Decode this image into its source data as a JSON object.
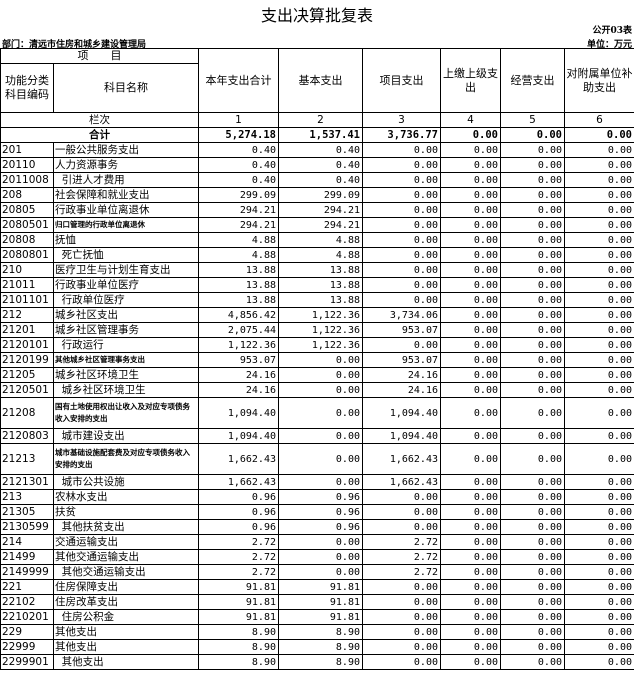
{
  "title": "支出决算批复表",
  "form_code": "公开03表",
  "department": "部门：清远市住房和城乡建设管理局",
  "unit": "单位：万元",
  "headers": {
    "item": "项　　目",
    "func_code": "功能分类科目编码",
    "item_name": "科目名称",
    "col1": "本年支出合计",
    "col2": "基本支出",
    "col3": "项目支出",
    "col4": "上缴上级支出",
    "col5": "经营支出",
    "col6": "对附属单位补助支出",
    "lanci": "栏次",
    "n1": "1",
    "n2": "2",
    "n3": "3",
    "n4": "4",
    "n5": "5",
    "n6": "6"
  },
  "total": {
    "label": "合计",
    "v1": "5,274.18",
    "v2": "1,537.41",
    "v3": "3,736.77",
    "v4": "0.00",
    "v5": "0.00",
    "v6": "0.00"
  },
  "rows": [
    {
      "code": "201",
      "name": "一般公共服务支出",
      "v1": "0.40",
      "v2": "0.40",
      "v3": "0.00",
      "v4": "0.00",
      "v5": "0.00",
      "v6": "0.00"
    },
    {
      "code": "20110",
      "name": "人力资源事务",
      "v1": "0.40",
      "v2": "0.40",
      "v3": "0.00",
      "v4": "0.00",
      "v5": "0.00",
      "v6": "0.00"
    },
    {
      "code": "2011008",
      "name": "  引进人才费用",
      "v1": "0.40",
      "v2": "0.40",
      "v3": "0.00",
      "v4": "0.00",
      "v5": "0.00",
      "v6": "0.00"
    },
    {
      "code": "208",
      "name": "社会保障和就业支出",
      "v1": "299.09",
      "v2": "299.09",
      "v3": "0.00",
      "v4": "0.00",
      "v5": "0.00",
      "v6": "0.00"
    },
    {
      "code": "20805",
      "name": "行政事业单位离退休",
      "v1": "294.21",
      "v2": "294.21",
      "v3": "0.00",
      "v4": "0.00",
      "v5": "0.00",
      "v6": "0.00"
    },
    {
      "code": "2080501",
      "name": "归口管理的行政单位离退休",
      "v1": "294.21",
      "v2": "294.21",
      "v3": "0.00",
      "v4": "0.00",
      "v5": "0.00",
      "v6": "0.00",
      "small": true
    },
    {
      "code": "20808",
      "name": "抚恤",
      "v1": "4.88",
      "v2": "4.88",
      "v3": "0.00",
      "v4": "0.00",
      "v5": "0.00",
      "v6": "0.00"
    },
    {
      "code": "2080801",
      "name": "  死亡抚恤",
      "v1": "4.88",
      "v2": "4.88",
      "v3": "0.00",
      "v4": "0.00",
      "v5": "0.00",
      "v6": "0.00"
    },
    {
      "code": "210",
      "name": "医疗卫生与计划生育支出",
      "v1": "13.88",
      "v2": "13.88",
      "v3": "0.00",
      "v4": "0.00",
      "v5": "0.00",
      "v6": "0.00"
    },
    {
      "code": "21011",
      "name": "行政事业单位医疗",
      "v1": "13.88",
      "v2": "13.88",
      "v3": "0.00",
      "v4": "0.00",
      "v5": "0.00",
      "v6": "0.00"
    },
    {
      "code": "2101101",
      "name": "  行政单位医疗",
      "v1": "13.88",
      "v2": "13.88",
      "v3": "0.00",
      "v4": "0.00",
      "v5": "0.00",
      "v6": "0.00"
    },
    {
      "code": "212",
      "name": "城乡社区支出",
      "v1": "4,856.42",
      "v2": "1,122.36",
      "v3": "3,734.06",
      "v4": "0.00",
      "v5": "0.00",
      "v6": "0.00"
    },
    {
      "code": "21201",
      "name": "城乡社区管理事务",
      "v1": "2,075.44",
      "v2": "1,122.36",
      "v3": "953.07",
      "v4": "0.00",
      "v5": "0.00",
      "v6": "0.00"
    },
    {
      "code": "2120101",
      "name": "  行政运行",
      "v1": "1,122.36",
      "v2": "1,122.36",
      "v3": "0.00",
      "v4": "0.00",
      "v5": "0.00",
      "v6": "0.00"
    },
    {
      "code": "2120199",
      "name": "其他城乡社区管理事务支出",
      "v1": "953.07",
      "v2": "0.00",
      "v3": "953.07",
      "v4": "0.00",
      "v5": "0.00",
      "v6": "0.00",
      "small": true
    },
    {
      "code": "21205",
      "name": "城乡社区环境卫生",
      "v1": "24.16",
      "v2": "0.00",
      "v3": "24.16",
      "v4": "0.00",
      "v5": "0.00",
      "v6": "0.00"
    },
    {
      "code": "2120501",
      "name": "  城乡社区环境卫生",
      "v1": "24.16",
      "v2": "0.00",
      "v3": "24.16",
      "v4": "0.00",
      "v5": "0.00",
      "v6": "0.00"
    },
    {
      "code": "21208",
      "name": "国有土地使用权出让收入及对应专项债务收入安排的支出",
      "v1": "1,094.40",
      "v2": "0.00",
      "v3": "1,094.40",
      "v4": "0.00",
      "v5": "0.00",
      "v6": "0.00",
      "small": true,
      "tall": true
    },
    {
      "code": "2120803",
      "name": "  城市建设支出",
      "v1": "1,094.40",
      "v2": "0.00",
      "v3": "1,094.40",
      "v4": "0.00",
      "v5": "0.00",
      "v6": "0.00"
    },
    {
      "code": "21213",
      "name": "城市基础设施配套费及对应专项债务收入安排的支出",
      "v1": "1,662.43",
      "v2": "0.00",
      "v3": "1,662.43",
      "v4": "0.00",
      "v5": "0.00",
      "v6": "0.00",
      "small": true,
      "tall": true
    },
    {
      "code": "2121301",
      "name": "  城市公共设施",
      "v1": "1,662.43",
      "v2": "0.00",
      "v3": "1,662.43",
      "v4": "0.00",
      "v5": "0.00",
      "v6": "0.00"
    },
    {
      "code": "213",
      "name": "农林水支出",
      "v1": "0.96",
      "v2": "0.96",
      "v3": "0.00",
      "v4": "0.00",
      "v5": "0.00",
      "v6": "0.00"
    },
    {
      "code": "21305",
      "name": "扶贫",
      "v1": "0.96",
      "v2": "0.96",
      "v3": "0.00",
      "v4": "0.00",
      "v5": "0.00",
      "v6": "0.00"
    },
    {
      "code": "2130599",
      "name": "  其他扶贫支出",
      "v1": "0.96",
      "v2": "0.96",
      "v3": "0.00",
      "v4": "0.00",
      "v5": "0.00",
      "v6": "0.00"
    },
    {
      "code": "214",
      "name": "交通运输支出",
      "v1": "2.72",
      "v2": "0.00",
      "v3": "2.72",
      "v4": "0.00",
      "v5": "0.00",
      "v6": "0.00"
    },
    {
      "code": "21499",
      "name": "其他交通运输支出",
      "v1": "2.72",
      "v2": "0.00",
      "v3": "2.72",
      "v4": "0.00",
      "v5": "0.00",
      "v6": "0.00"
    },
    {
      "code": "2149999",
      "name": "  其他交通运输支出",
      "v1": "2.72",
      "v2": "0.00",
      "v3": "2.72",
      "v4": "0.00",
      "v5": "0.00",
      "v6": "0.00"
    },
    {
      "code": "221",
      "name": "住房保障支出",
      "v1": "91.81",
      "v2": "91.81",
      "v3": "0.00",
      "v4": "0.00",
      "v5": "0.00",
      "v6": "0.00"
    },
    {
      "code": "22102",
      "name": "住房改革支出",
      "v1": "91.81",
      "v2": "91.81",
      "v3": "0.00",
      "v4": "0.00",
      "v5": "0.00",
      "v6": "0.00"
    },
    {
      "code": "2210201",
      "name": "  住房公积金",
      "v1": "91.81",
      "v2": "91.81",
      "v3": "0.00",
      "v4": "0.00",
      "v5": "0.00",
      "v6": "0.00"
    },
    {
      "code": "229",
      "name": "其他支出",
      "v1": "8.90",
      "v2": "8.90",
      "v3": "0.00",
      "v4": "0.00",
      "v5": "0.00",
      "v6": "0.00"
    },
    {
      "code": "22999",
      "name": "其他支出",
      "v1": "8.90",
      "v2": "8.90",
      "v3": "0.00",
      "v4": "0.00",
      "v5": "0.00",
      "v6": "0.00"
    },
    {
      "code": "2299901",
      "name": "  其他支出",
      "v1": "8.90",
      "v2": "8.90",
      "v3": "0.00",
      "v4": "0.00",
      "v5": "0.00",
      "v6": "0.00"
    }
  ]
}
